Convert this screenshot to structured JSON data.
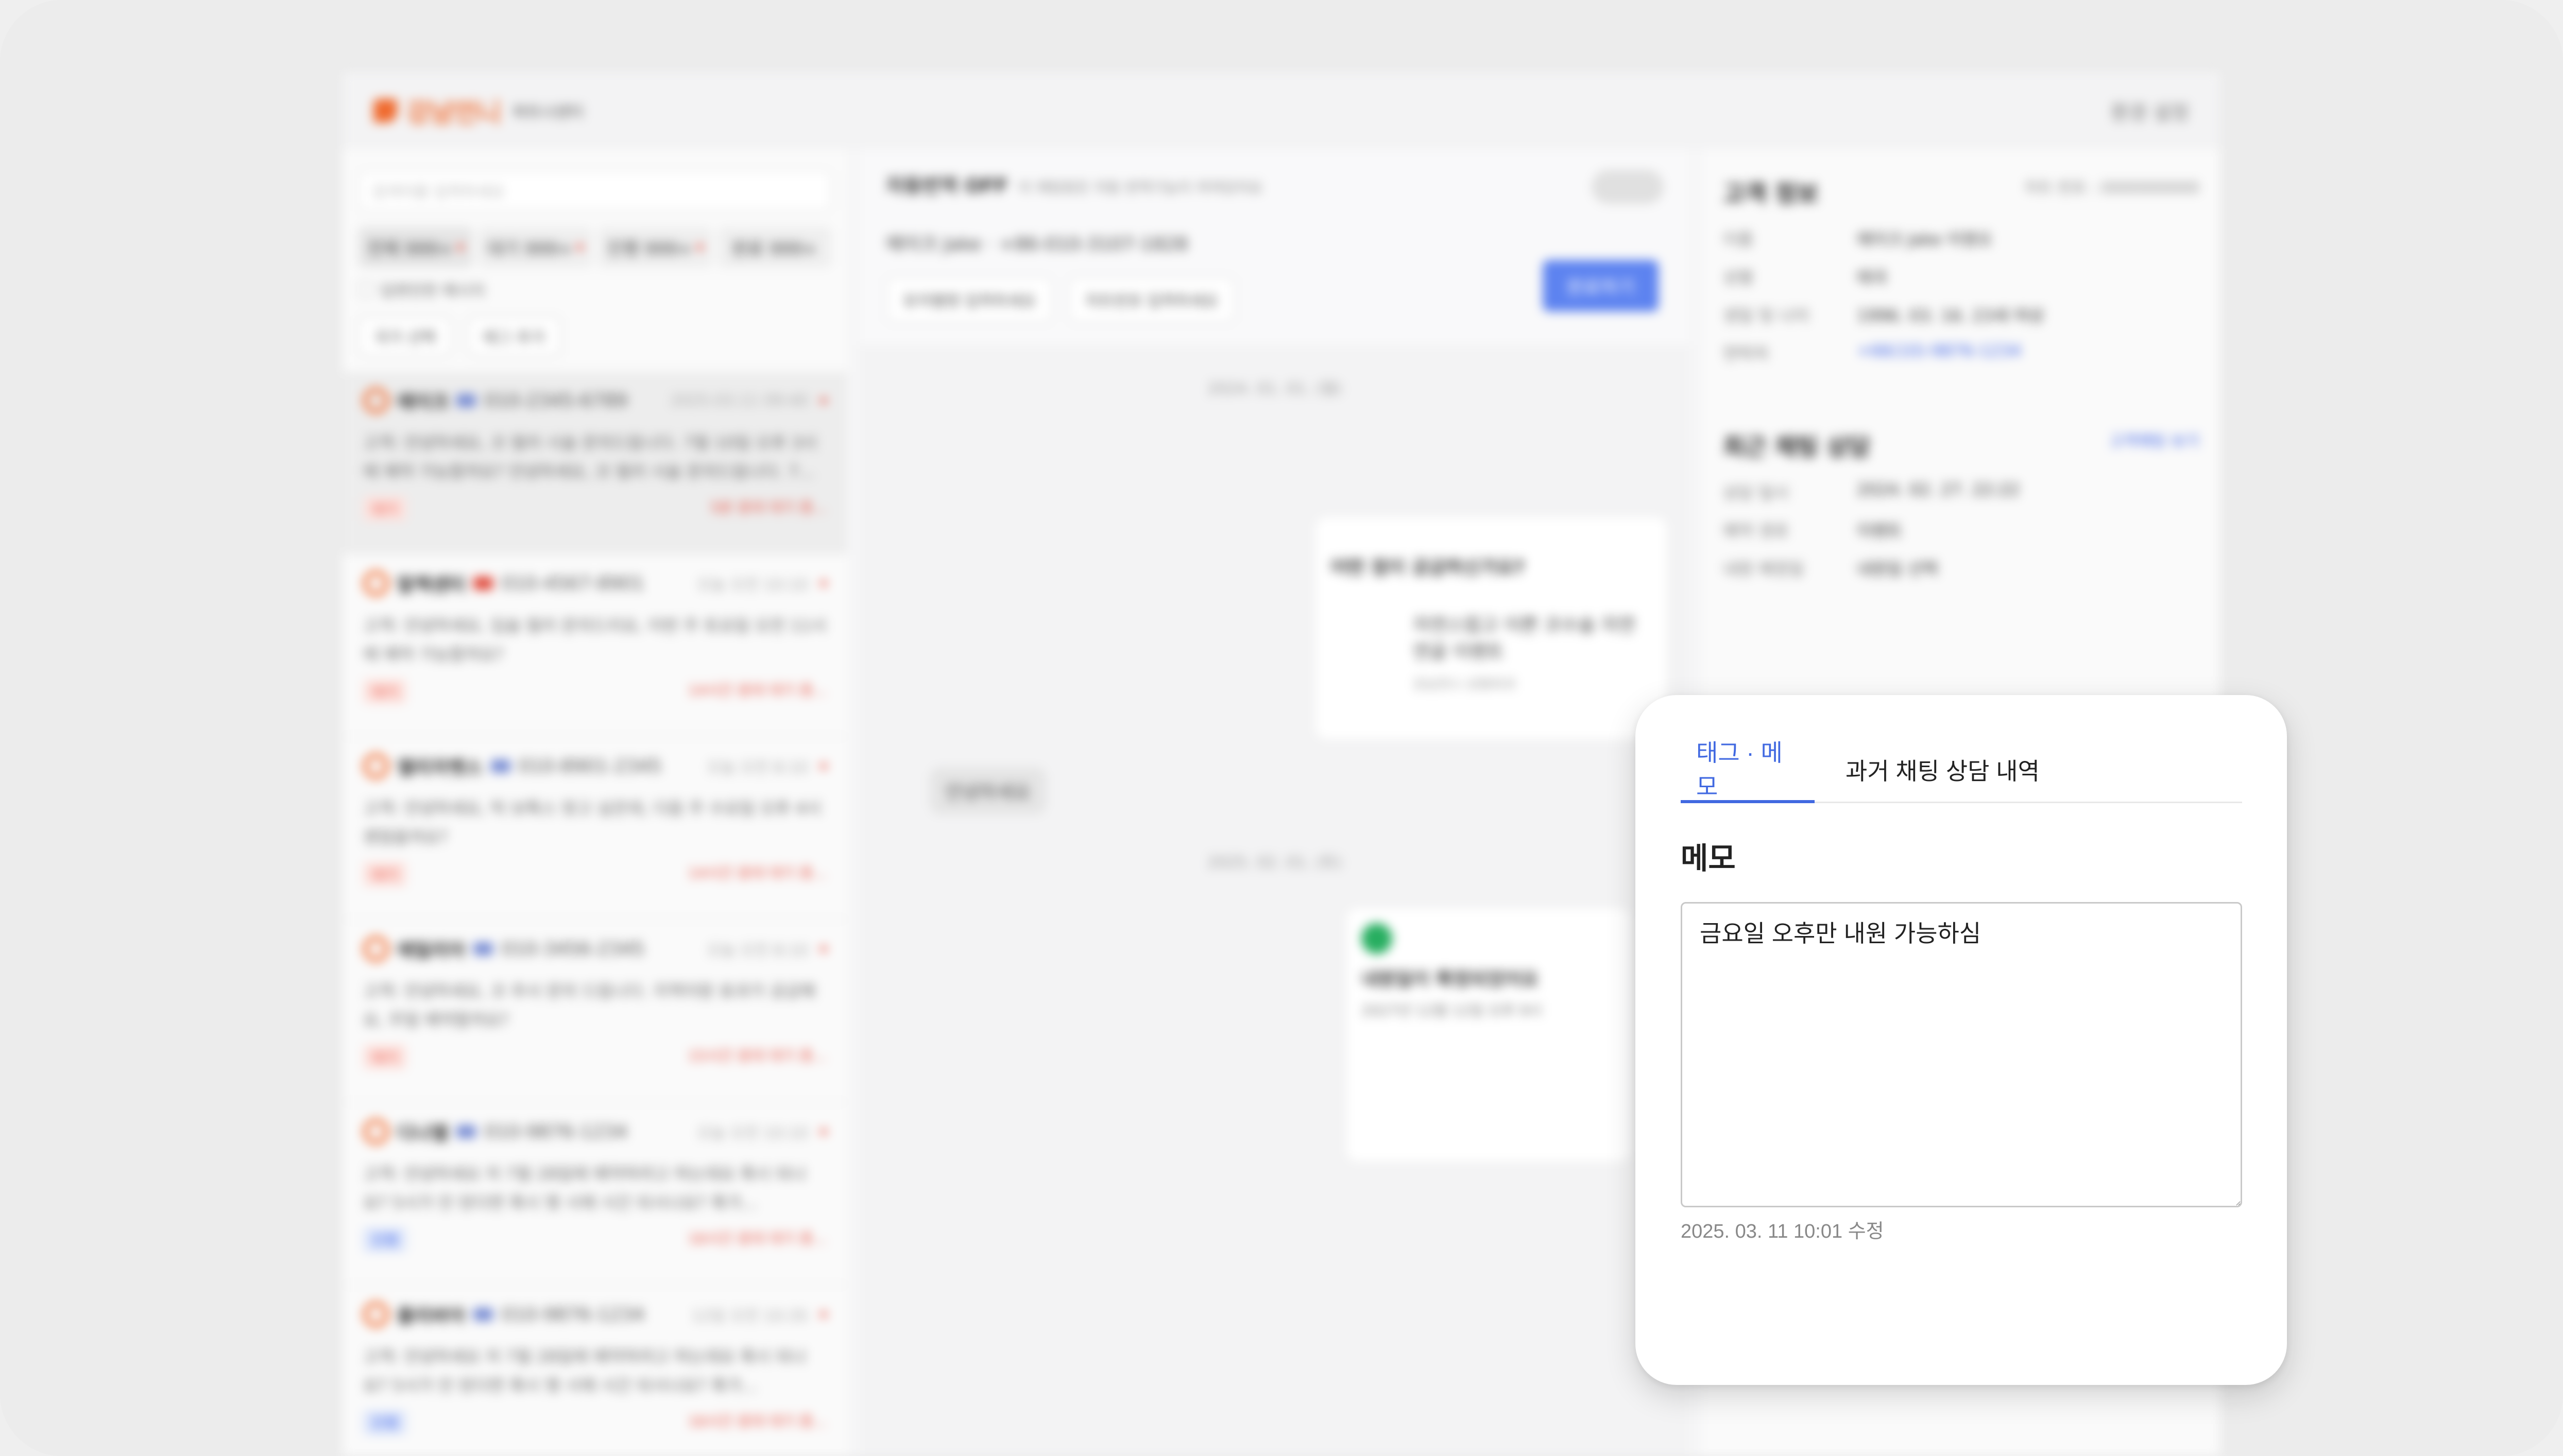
{
  "app": {
    "brand": "강남언니",
    "brand_sub": "파트너센터",
    "header_right": "환경 설정",
    "search_placeholder": "검색어를 입력하세요",
    "status_tabs": [
      {
        "label": "전체 999+"
      },
      {
        "label": "대기 999+"
      },
      {
        "label": "진행 999+"
      },
      {
        "label": "완료 999+"
      }
    ],
    "unanswered_label": "답변안한 메시지",
    "filters": [
      "국가 선택",
      "태그 추가"
    ],
    "conversations": [
      {
        "name": "에이크",
        "phone": "010-2345-6789",
        "time": "2025.03.11 09:40",
        "message": "고객: 안녕하세요, 코 필러 시술 문의드립니다. 7월 10일 오후 3시에 예약 가능할까요? 안녕하세요, 코 필러 시술 문의드립니다. 7...",
        "tag": "대기",
        "wait": "5분 응대 대기 중..."
      },
      {
        "name": "말젝센터",
        "phone": "010-4567-8901",
        "time": "오늘 오전 10:10",
        "message": "고객: 안녕하세요, 입술 필러 문의드리요, 이번 주 토요일 오전 11시에 예약 가능할까요?",
        "tag": "대기",
        "wait": "14시간 응대 대기 중..."
      },
      {
        "name": "엘리자벳스",
        "phone": "010-8901-2345",
        "time": "오늘 오전 8:10",
        "message": "고객: 안녕하세요, 턱 보톡스 맞고 싶은데, 다음 주 수요일 오후 4시 괜찮을까요?",
        "tag": "대기",
        "wait": "14시간 응대 대기 중..."
      },
      {
        "name": "에밀리아",
        "phone": "010-3456-2345",
        "time": "오늘 오전 8:10",
        "message": "고객: 안녕하세요, 코 추사 문의 드립니다. 지역이랑 효과가 궁금해요, 무얼 예약할까요?",
        "tag": "대기",
        "wait": "15시간 응대 대기 중..."
      },
      {
        "name": "디나엘",
        "phone": "010-9876-1234",
        "time": "오늘 오전 10:10",
        "message": "고객: 안녕하세요 저 7월 28일에 예약하려고 하는데요 혹시 되나요? 5시가 안 된다면 혹시 몇 시에 시간 되시나요? 혹가...",
        "tag": "진행",
        "wait": "16시간 응대 대기 중..."
      },
      {
        "name": "줄리바아",
        "phone": "010-9876-1234",
        "time": "12일 오전 10:35",
        "message": "고객: 안녕하세요 저 7월 28일에 예약하려고 하는데요 혹시 되나요? 5시가 안 된다면 혹시 몇 시에 시간 되시나요? 혹가...",
        "tag": "진행",
        "wait": "16시간 응대 대기 중..."
      }
    ],
    "chat": {
      "title": "자동번역 OFF",
      "title_sub": "이 채팅방은 자동 번역기능이 꺼져있어요",
      "customer_line": "에이크 Jake · +86-010-3107-1828",
      "fields": [
        "유저별명 입력하세요",
        "차트번호 입력하세요"
      ],
      "done_label": "완료하기",
      "date1": "2024. 01. 01. (월)",
      "card_q": "어떤 점이 궁금하신가요?",
      "card_item": "자연스럽고 이쁜 코수술 자연 연골 이벤트",
      "card_item_sub": "강남언니 성형외과",
      "greet": "안녕하세요",
      "date2": "2025. 02. 01. (토)",
      "confirm_title": "내원일이 확정되었어요",
      "confirm_date": "2027년 12월 12일 오후 9시"
    },
    "customer": {
      "title": "고객 정보",
      "chart_no": "차트 번호 : 0000000000",
      "rows": [
        {
          "k": "이름",
          "v": "에이크 Jake 이영오"
        },
        {
          "k": "성별",
          "v": "태국"
        },
        {
          "k": "생일 및 나이",
          "v": "1996. 03. 16. 23세 여성"
        },
        {
          "k": "연락처",
          "v": "+66(10)-9876-1234"
        }
      ],
      "recent_title": "최근 채팅 상담",
      "recent_link": "고객채팅 보기",
      "recent_rows": [
        {
          "k": "상담 일시",
          "v": "2024. 02. 27. 22:22"
        },
        {
          "k": "예약 경로",
          "v": "이벤트"
        },
        {
          "k": "내원 예정일",
          "v": "내원일 선택"
        }
      ]
    }
  },
  "panel": {
    "tabs": [
      {
        "label": "태그 · 메모"
      },
      {
        "label": "과거 채팅 상담 내역"
      }
    ],
    "memo_title": "메모",
    "memo_value": "금요일 오후만 내원 가능하심",
    "memo_meta": "2025. 03. 11 10:01 수정"
  },
  "colors": {
    "accent": "#4169e1",
    "brand": "#f06a2e"
  }
}
